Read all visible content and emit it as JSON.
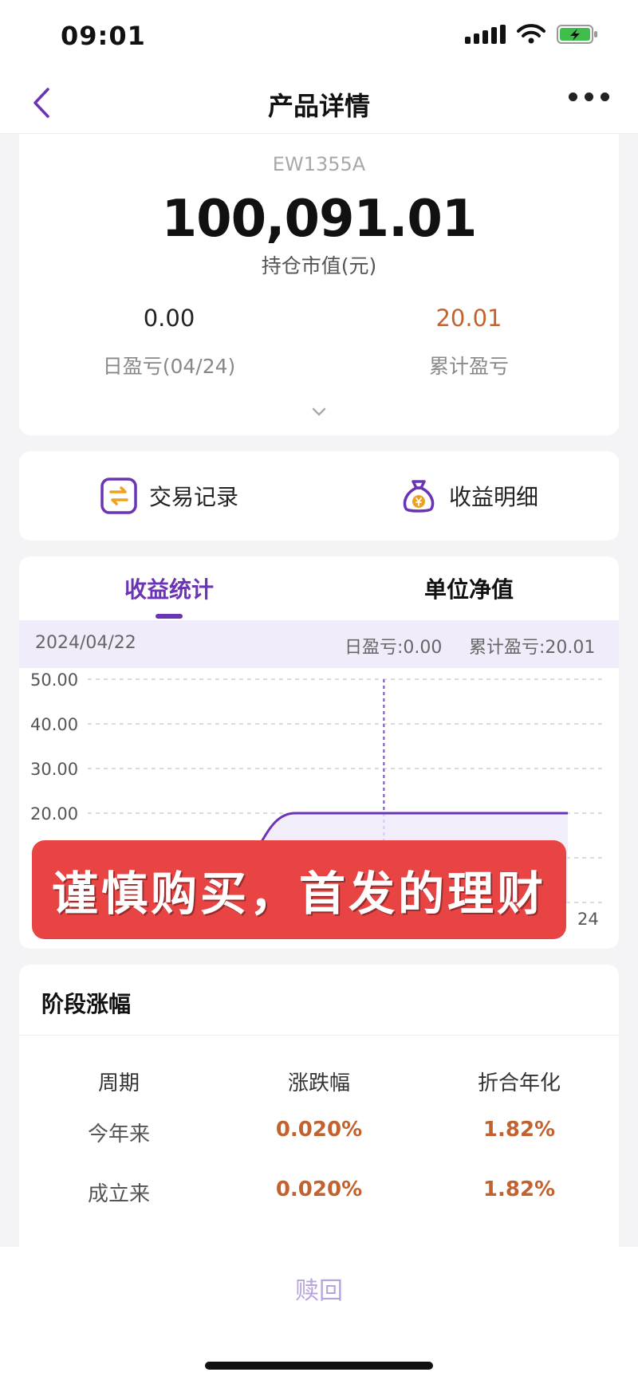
{
  "status_bar": {
    "time": "09:01"
  },
  "nav": {
    "title": "产品详情"
  },
  "summary": {
    "product_code": "EW1355A",
    "market_value": "100,091.01",
    "market_label": "持仓市值(元)",
    "daily_pnl_value": "0.00",
    "daily_pnl_label": "日盈亏(04/24)",
    "cum_pnl_value": "20.01",
    "cum_pnl_label": "累计盈亏"
  },
  "actions": {
    "trade_records": "交易记录",
    "income_details": "收益明细"
  },
  "chart_tabs": {
    "income_stats": "收益统计",
    "unit_nav": "单位净值"
  },
  "info_strip": {
    "date": "2024/04/22",
    "daily": "日盈亏:0.00",
    "cumulative": "累计盈亏:20.01"
  },
  "chart_data": {
    "type": "line",
    "y_ticks": [
      "50.00",
      "40.00",
      "30.00",
      "20.00"
    ],
    "ylim": [
      0,
      50
    ],
    "x": [
      0,
      1,
      2,
      3,
      4,
      5,
      6,
      7
    ],
    "x_partial_label": "24",
    "series": [
      {
        "values": [
          0,
          3,
          7,
          20,
          20,
          20,
          20,
          20
        ]
      }
    ],
    "crosshair_x": 4.3,
    "grid": true
  },
  "banner": {
    "text": "谨慎购买，首发的理财"
  },
  "period": {
    "title": "阶段涨幅",
    "headers": [
      "周期",
      "涨跌幅",
      "折合年化"
    ],
    "rows": [
      [
        "今年来",
        "0.020%",
        "1.82%"
      ],
      [
        "成立来",
        "0.020%",
        "1.82%"
      ]
    ]
  },
  "bottom": {
    "redeem": "赎回"
  },
  "colors": {
    "accent_purple": "#6a34b5",
    "orange": "#c2622f",
    "banner_red": "#e84444"
  }
}
